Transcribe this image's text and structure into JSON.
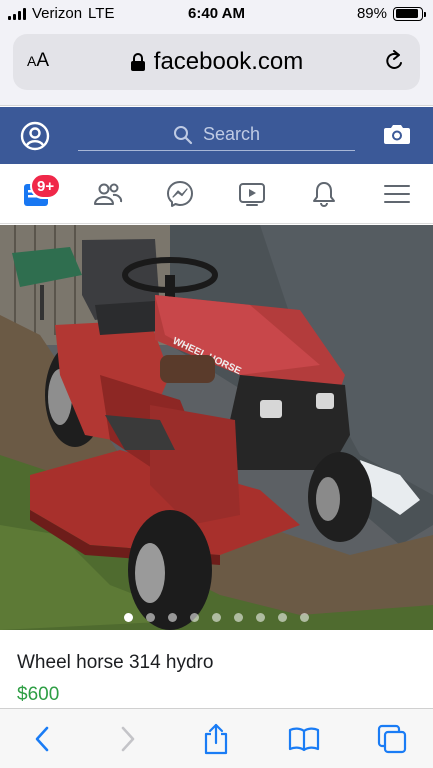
{
  "status_bar": {
    "carrier": "Verizon",
    "network": "LTE",
    "time": "6:40 AM",
    "battery_percent": "89%",
    "battery_level": 0.89
  },
  "browser": {
    "text_size_label_small": "A",
    "text_size_label_large": "A",
    "url": "facebook.com",
    "lock_icon": "lock-icon",
    "reload_icon": "reload-icon"
  },
  "fb_header": {
    "search_placeholder": "Search",
    "brand_color": "#3b5998"
  },
  "fb_nav": {
    "items": [
      "news-feed-icon",
      "friends-icon",
      "messenger-icon",
      "watch-icon",
      "notifications-icon",
      "menu-icon"
    ],
    "feed_badge": "9+"
  },
  "listing": {
    "title": "Wheel horse 314 hydro",
    "price": "$600",
    "price_color": "#2e9e44",
    "photo_count": 9,
    "active_photo": 1
  },
  "toolbar": {
    "items": [
      "back-icon",
      "forward-icon",
      "share-icon",
      "bookmarks-icon",
      "tabs-icon"
    ]
  }
}
